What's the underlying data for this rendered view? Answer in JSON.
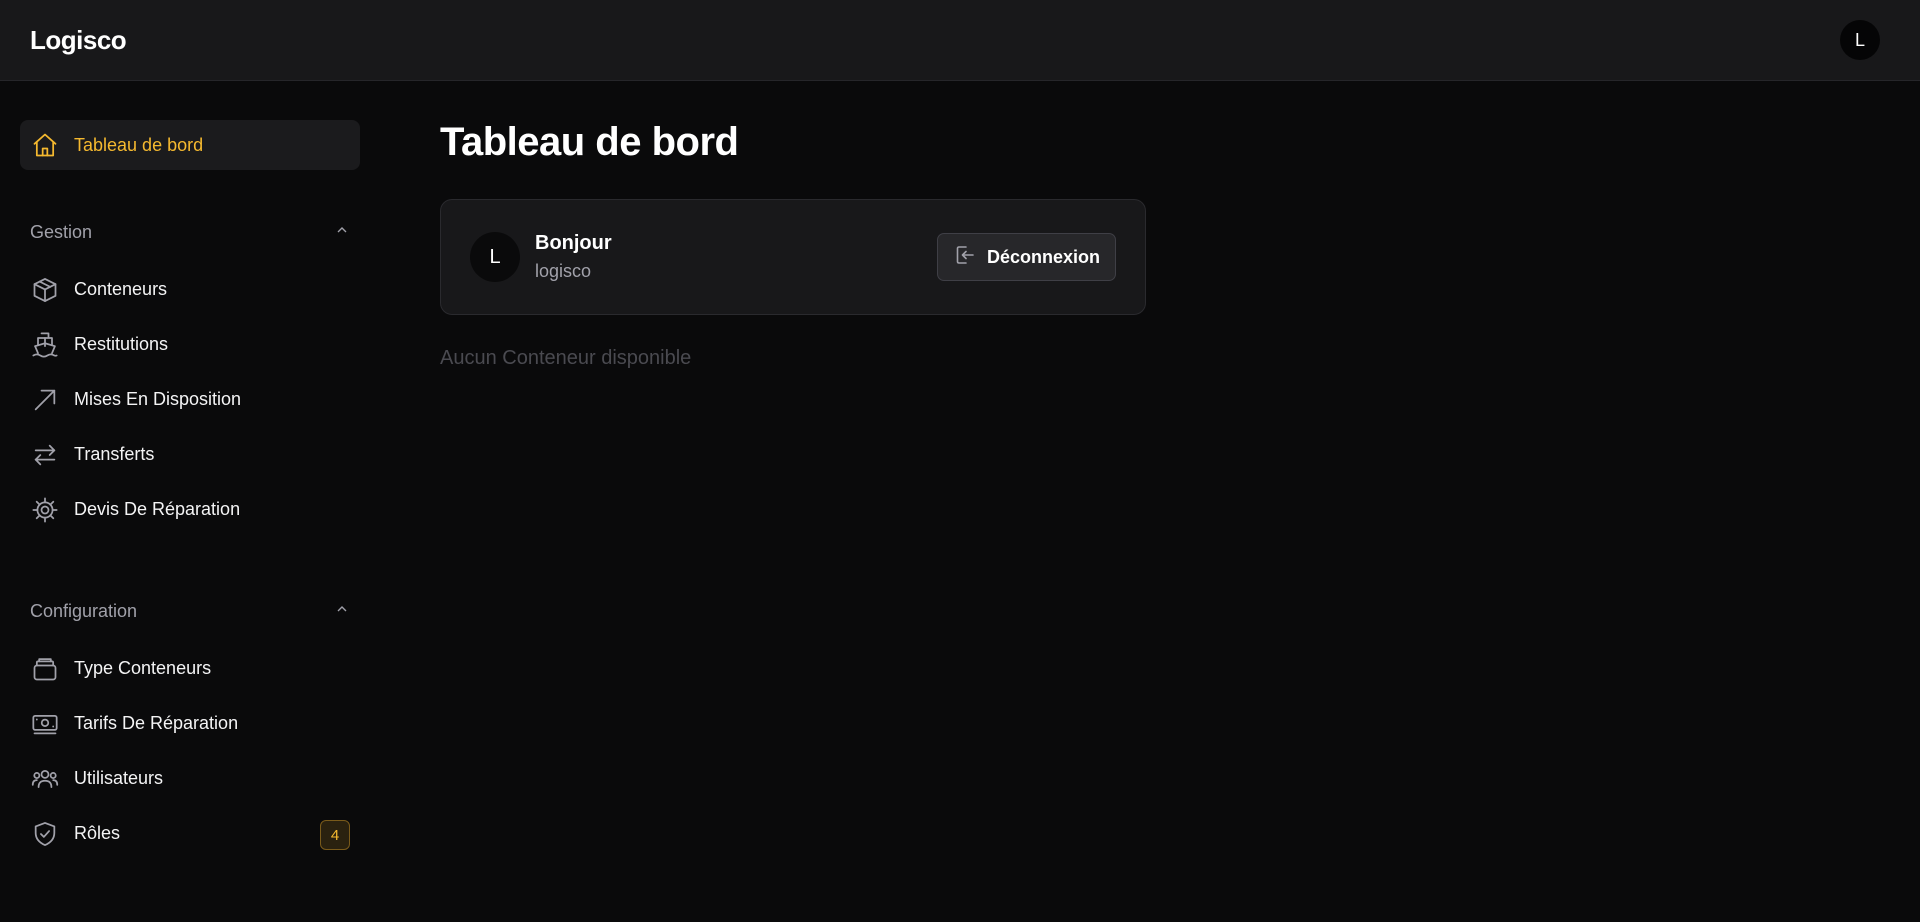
{
  "app": {
    "brand": "Logisco",
    "avatar_initial": "L"
  },
  "sidebar": {
    "active": {
      "label": "Tableau de bord",
      "icon": "home-icon"
    },
    "sections": [
      {
        "title": "Gestion",
        "items": [
          {
            "label": "Conteneurs",
            "icon": "cube-icon"
          },
          {
            "label": "Restitutions",
            "icon": "ship-icon"
          },
          {
            "label": "Mises En Disposition",
            "icon": "arrow-up-right-icon"
          },
          {
            "label": "Transferts",
            "icon": "swap-arrows-icon"
          },
          {
            "label": "Devis De Réparation",
            "icon": "cog-icon"
          }
        ]
      },
      {
        "title": "Configuration",
        "items": [
          {
            "label": "Type Conteneurs",
            "icon": "stack-icon"
          },
          {
            "label": "Tarifs De Réparation",
            "icon": "banknote-icon"
          },
          {
            "label": "Utilisateurs",
            "icon": "users-icon"
          },
          {
            "label": "Rôles",
            "icon": "shield-check-icon",
            "badge": "4"
          }
        ]
      }
    ]
  },
  "main": {
    "title": "Tableau de bord",
    "welcome": {
      "avatar_initial": "L",
      "greeting": "Bonjour",
      "username": "logisco",
      "logout_label": "Déconnexion"
    },
    "empty_message": "Aucun Conteneur disponible"
  },
  "colors": {
    "accent": "#f5b92f",
    "background": "#0a0a0b",
    "surface": "#18181a",
    "muted_text": "#a1a1aa"
  }
}
